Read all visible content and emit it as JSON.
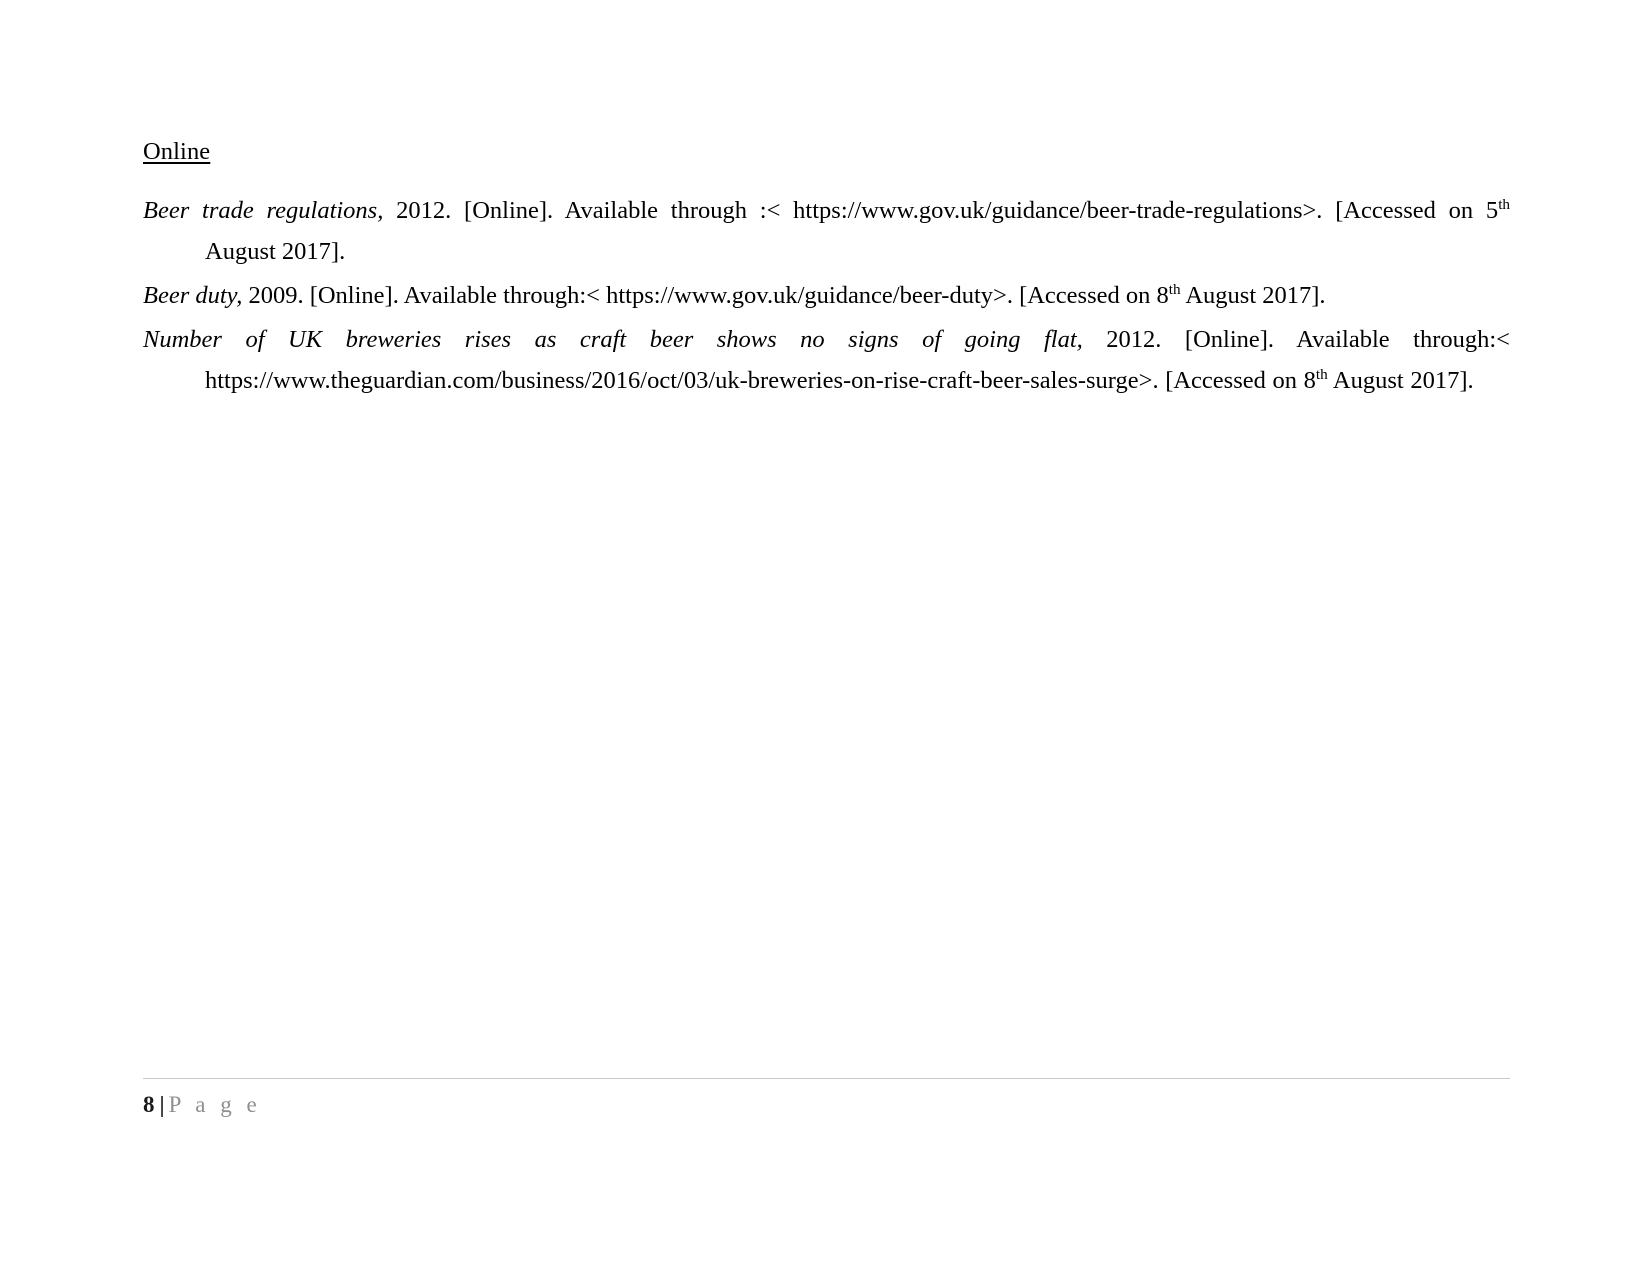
{
  "document": {
    "heading": "Online",
    "references": [
      {
        "title": "Beer trade regulations,",
        "rest_before_ordinal": " 2012. [Online]. Available through :< https://www.gov.uk/guidance/beer-trade-regulations>. [Accessed on 5",
        "ordinal_suffix": "th",
        "rest_after_ordinal": " August 2017]."
      },
      {
        "title": "Beer duty,",
        "rest_before_ordinal": " 2009. [Online]. Available through:< https://www.gov.uk/guidance/beer-duty>. [Accessed on 8",
        "ordinal_suffix": "th",
        "rest_after_ordinal": " August 2017]."
      },
      {
        "title": "Number of UK breweries rises as craft beer shows no signs of going flat,",
        "rest_before_ordinal": " 2012. [Online]. Available through:< https://www.theguardian.com/business/2016/oct/03/uk-breweries-on-rise-craft-beer-sales-surge>. [Accessed on 8",
        "ordinal_suffix": "th",
        "rest_after_ordinal": " August 2017]."
      }
    ]
  },
  "footer": {
    "page_number": "8",
    "separator": "|",
    "label": "P a g e"
  }
}
